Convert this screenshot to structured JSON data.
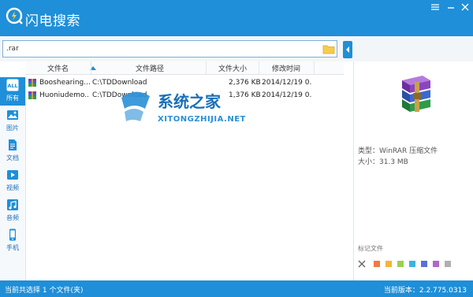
{
  "app": {
    "title": "闪电搜索"
  },
  "search": {
    "value": ".rar"
  },
  "columns": {
    "name": "文件名",
    "path": "文件路径",
    "size": "文件大小",
    "modified": "修改时间"
  },
  "files": [
    {
      "name": "Booshearing...",
      "path": "C:\\TDDownload",
      "size": "2,376 KB",
      "modified": "2014/12/19 0..."
    },
    {
      "name": "Huoniudemo...",
      "path": "C:\\TDDownload",
      "size": "1,376 KB",
      "modified": "2014/12/19 0..."
    }
  ],
  "sidebar": {
    "items": [
      {
        "label": "所有",
        "badge": "ALL",
        "icon": "all-icon",
        "active": true
      },
      {
        "label": "图片",
        "icon": "image-icon"
      },
      {
        "label": "文档",
        "icon": "document-icon"
      },
      {
        "label": "视频",
        "icon": "video-icon"
      },
      {
        "label": "音频",
        "icon": "audio-icon"
      },
      {
        "label": "手机",
        "icon": "phone-icon"
      }
    ]
  },
  "details": {
    "type": "类型：WinRAR 压缩文件",
    "size": "大小：31.3 MB"
  },
  "tags": {
    "title": "标记文件",
    "colors": [
      "#f07a45",
      "#f4b43a",
      "#9bd14a",
      "#3ab5e0",
      "#5b6fd6",
      "#b266cc",
      "#b0b0b0"
    ]
  },
  "status": {
    "left": "当前共选择 1 个文件(夹)",
    "right": "当前版本：2.2.775.0313"
  },
  "watermark": {
    "text": "系统之家",
    "sub": "XITONGZHIJIA.NET"
  },
  "colors": {
    "accent": "#1e8fd8"
  }
}
